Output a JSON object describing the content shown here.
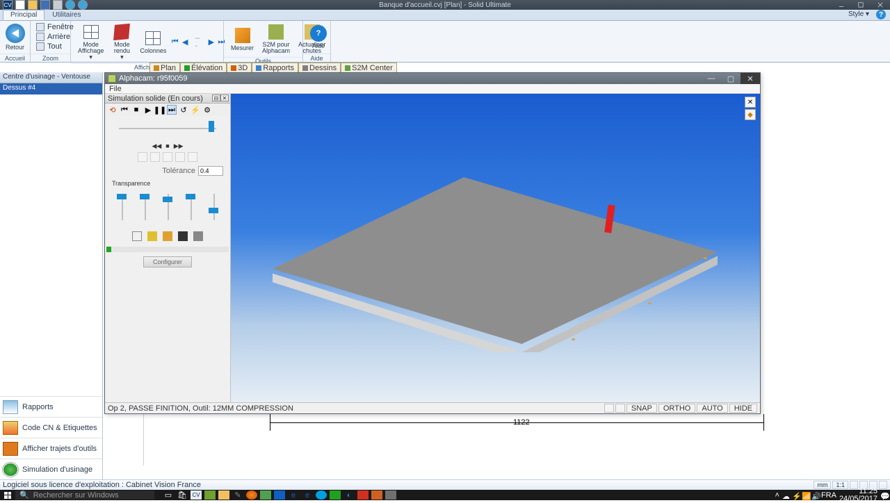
{
  "app": {
    "title": "Banque d'accueil.cvj [Plan] - Solid Ultimate",
    "style_label": "Style ▾"
  },
  "ribbon_tabs": {
    "principal": "Principal",
    "utilitaires": "Utilitaires"
  },
  "ribbon": {
    "accueil": {
      "retour": "Retour",
      "group": "Accueil"
    },
    "zoom": {
      "fenetre": "Fenêtre",
      "arriere": "Arrière",
      "tout": "Tout",
      "group": "Zoom"
    },
    "affichage": {
      "mode_affichage": "Mode\nAffichage ▾",
      "mode_rendu": "Mode\nrendu ▾",
      "colonnes": "Colonnes",
      "group": "Affichage"
    },
    "media": {
      "dash": "---"
    },
    "outils": {
      "mesurer": "Mesurer",
      "s2m": "S2M pour\nAlphacam",
      "actualiser": "Actualiser\nchutes",
      "group": "Outils"
    },
    "aide": {
      "aide": "Aide",
      "group": "Aide"
    }
  },
  "subtabs": [
    "Plan",
    "Élévation",
    "3D",
    "Rapports",
    "Dessins",
    "S2M Center"
  ],
  "left": {
    "header": "Centre d'usinage - Ventouse",
    "item": "Dessus #4",
    "cats": {
      "rapports": "Rapports",
      "code": "Code CN & Etiquettes",
      "trajets": "Afficher trajets d'outils",
      "sim": "Simulation d'usinage"
    }
  },
  "alphacam": {
    "title": "Alphacam: r95f0059",
    "menu": "File",
    "sim": {
      "header": "Simulation solide (En cours)",
      "tolerance_label": "Tolérance",
      "tolerance_value": "0.4",
      "transparence": "Transparence",
      "configurer": "Configurer",
      "playback": {
        "rew": "◀◀",
        "stop": "■",
        "ff": "▶▶"
      }
    },
    "status": {
      "left": "Op 2, PASSE FINITION, Outil: 12MM COMPRESSION",
      "snap": "SNAP",
      "ortho": "ORTHO",
      "auto": "AUTO",
      "hide": "HIDE"
    }
  },
  "main": {
    "dim": "1122"
  },
  "mainstatus": {
    "text": "Logiciel sous licence d'exploitation : Cabinet Vision France",
    "mm": "mm",
    "ratio": "1:1"
  },
  "taskbar": {
    "search_placeholder": "Rechercher sur Windows",
    "time": "11:25",
    "date": "24/05/2017",
    "lang": "FRA"
  }
}
